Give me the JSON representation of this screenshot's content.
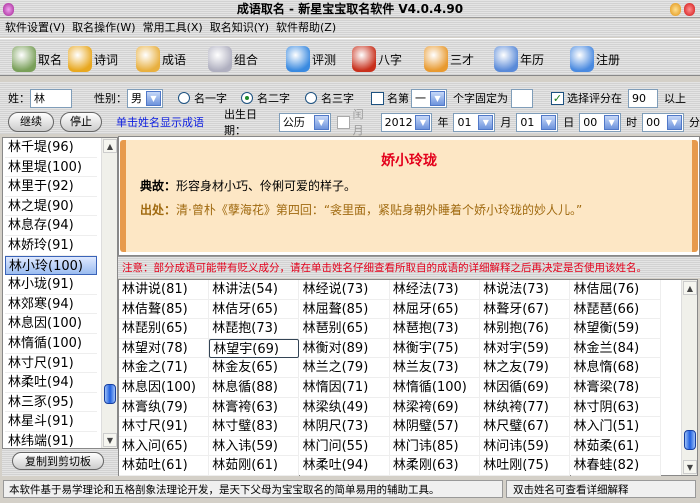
{
  "window": {
    "title": "成语取名 - 新星宝宝取名软件 V4.0.4.90"
  },
  "menu": [
    "软件设置(V)",
    "取名操作(W)",
    "常用工具(X)",
    "取名知识(Y)",
    "软件帮助(Z)"
  ],
  "toolbar": [
    {
      "label": "取名",
      "icon": "id-card-icon",
      "color": "#7aa05a"
    },
    {
      "label": "诗词",
      "icon": "scroll-icon",
      "color": "#e8a820"
    },
    {
      "label": "成语",
      "icon": "book-icon",
      "color": "#e8b040"
    },
    {
      "label": "组合",
      "icon": "cone-star-icon",
      "color": "#b0b0c0"
    },
    {
      "label": "评测",
      "icon": "magnifier-icon",
      "color": "#3a8ae0"
    },
    {
      "label": "八字",
      "icon": "clock-icon",
      "color": "#c8301c"
    },
    {
      "label": "三才",
      "icon": "people-icon",
      "color": "#e89a30"
    },
    {
      "label": "年历",
      "icon": "calendar-icon",
      "color": "#5a8ad8"
    },
    {
      "label": "注册",
      "icon": "user-lock-icon",
      "color": "#4a8ae0"
    }
  ],
  "form": {
    "surname_label": "姓：",
    "surname": "林",
    "gender_label": "性别：",
    "gender": "男",
    "radio1": "名一字",
    "radio2": "名二字",
    "radio3": "名三字",
    "fix_label": "名第",
    "fix_pos": "一",
    "fix_suffix": "个字固定为",
    "fix_value": "",
    "score_label": "选择评分在",
    "score": "90",
    "score_suffix": "以上",
    "continue": "继续",
    "stop": "停止",
    "hint": "单击姓名显示成语",
    "birth_label": "出生日期：",
    "calendar": "公历",
    "leap": "闰月",
    "year": "2012",
    "year_u": "年",
    "month": "01",
    "month_u": "月",
    "day": "01",
    "day_u": "日",
    "hour": "00",
    "hour_u": "时",
    "minute": "00",
    "minute_u": "分"
  },
  "names": [
    "林千堤(96)",
    "林里堤(100)",
    "林里于(92)",
    "林之堤(90)",
    "林息存(94)",
    "林娇玲(91)",
    "林小玲(100)",
    "林小珑(91)",
    "林郊寒(94)",
    "林息因(100)",
    "林惰循(100)",
    "林寸尺(91)",
    "林柔吐(94)",
    "林三豕(95)",
    "林星斗(91)",
    "林纬端(91)"
  ],
  "selected_name_index": 6,
  "copy_button": "复制到剪切板",
  "idiom": {
    "title": "娇小玲珑",
    "allusion_label": "典故：",
    "allusion": "形容身材小巧、伶俐可爱的样子。",
    "source_label": "出处：",
    "source": "清·曾朴《孽海花》第四回：“衾里面，紧贴身朝外睡着个娇小玲珑的妙人儿。”"
  },
  "warning": "注意：部分成语可能带有贬义成分，请在单击姓名仔细查看所取自的成语的详细解释之后再决定是否使用该姓名。",
  "grid": [
    [
      "林讲说(81)",
      "林讲法(54)",
      "林经说(73)",
      "林经法(73)",
      "林说法(73)",
      "林佶屈(76)"
    ],
    [
      "林佶聱(85)",
      "林佶牙(65)",
      "林屈聱(85)",
      "林屈牙(65)",
      "林聱牙(67)",
      "林琵琶(66)"
    ],
    [
      "林琵别(65)",
      "林琵抱(73)",
      "林琶别(65)",
      "林琶抱(73)",
      "林别抱(76)",
      "林望衡(59)"
    ],
    [
      "林望对(78)",
      "林望宇(69)",
      "林衡对(89)",
      "林衡宇(75)",
      "林对宇(59)",
      "林金兰(84)"
    ],
    [
      "林金之(71)",
      "林金友(65)",
      "林兰之(79)",
      "林兰友(73)",
      "林之友(79)",
      "林息惰(68)"
    ],
    [
      "林息因(100)",
      "林息循(88)",
      "林惰因(71)",
      "林惰循(100)",
      "林因循(69)",
      "林膏梁(78)"
    ],
    [
      "林膏纨(79)",
      "林膏袴(63)",
      "林梁纨(49)",
      "林梁袴(69)",
      "林纨袴(77)",
      "林寸阴(63)"
    ],
    [
      "林寸尺(91)",
      "林寸璧(83)",
      "林阴尺(73)",
      "林阴璧(57)",
      "林尺璧(67)",
      "林入门(51)"
    ],
    [
      "林入问(65)",
      "林入讳(59)",
      "林门问(55)",
      "林门讳(85)",
      "林问讳(59)",
      "林茹柔(61)"
    ],
    [
      "林茹吐(61)",
      "林茹刚(61)",
      "林柔吐(94)",
      "林柔刚(63)",
      "林吐刚(75)",
      "林春蛙(82)"
    ]
  ],
  "focused_cell": [
    3,
    1
  ],
  "status": {
    "left": "本软件基于易学理论和五格剖象法理论开发，是天下父母为宝宝取名的简单易用的辅助工具。",
    "right": "双击姓名可查看详细解释"
  }
}
